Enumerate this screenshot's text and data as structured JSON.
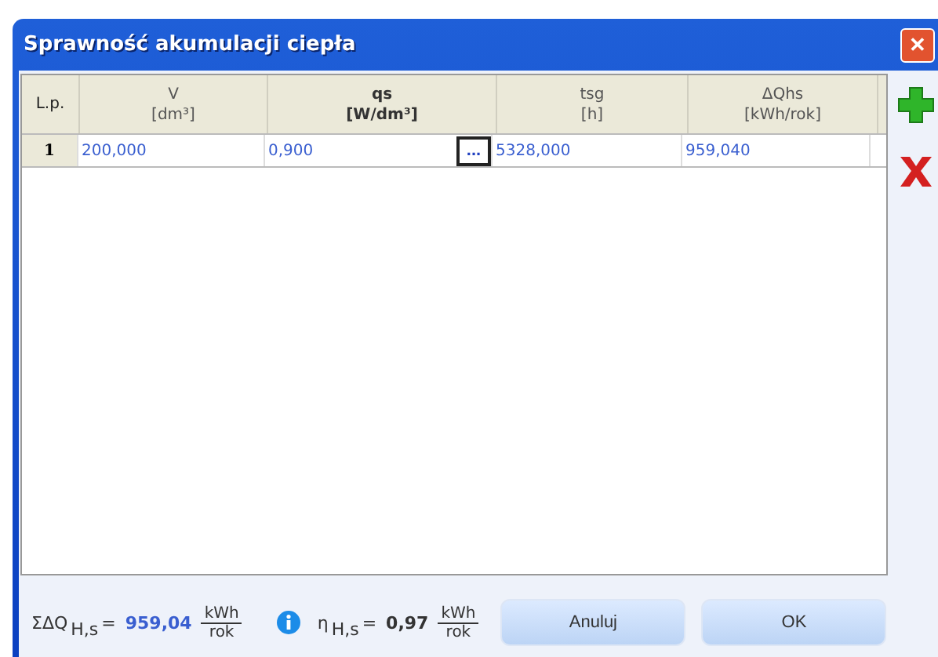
{
  "window": {
    "title": "Sprawność akumulacji ciepła",
    "close": "✕"
  },
  "table": {
    "columns": [
      {
        "label": "L.p.",
        "bold": false
      },
      {
        "label": "V",
        "unit": "[dm³]",
        "bold": false
      },
      {
        "label": "qs",
        "unit": "[W/dm³]",
        "bold": true
      },
      {
        "label": "tsg",
        "unit": "[h]",
        "bold": false
      },
      {
        "label": "ΔQhs",
        "unit": "[kWh/rok]",
        "bold": false
      }
    ],
    "rows": [
      {
        "lp": "1",
        "cells": [
          "200,000",
          "0,900",
          "5328,000",
          "959,040"
        ],
        "picker": "..."
      }
    ]
  },
  "footer": {
    "sum": {
      "symbol": "ΣΔQ",
      "subscript": "H,s",
      "equals": "=",
      "value": "959,04",
      "numerator": "kWh",
      "denominator": "rok",
      "accent": true
    },
    "efficiency": {
      "symbol": "η",
      "subscript": "H,s",
      "equals": "=",
      "value": "0,97",
      "numerator": "kWh",
      "denominator": "rok",
      "accent": false
    },
    "buttons": [
      "Anuluj",
      "OK"
    ]
  }
}
